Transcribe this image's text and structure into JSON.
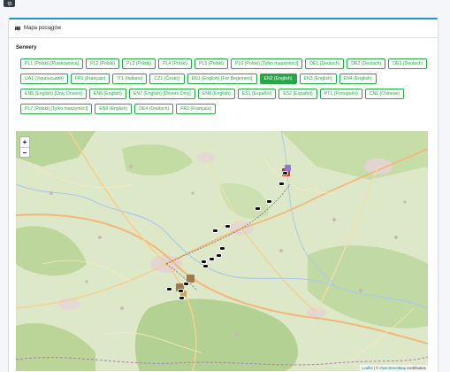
{
  "header": {
    "title": "Mapa pociągów"
  },
  "section_label": "Serwery",
  "servers": [
    {
      "label": "PL1 (Polski) [Piaskownica]",
      "active": false
    },
    {
      "label": "PL2 (Polski)",
      "active": false
    },
    {
      "label": "PL3 (Polski)",
      "active": false
    },
    {
      "label": "PL4 (Polski)",
      "active": false
    },
    {
      "label": "PL5 (Polski)",
      "active": false
    },
    {
      "label": "PL6 (Polski) [Tylko maszyniści]",
      "active": false
    },
    {
      "label": "DE1 (Deutsch)",
      "active": false
    },
    {
      "label": "DE2 (Deutsch)",
      "active": false
    },
    {
      "label": "DE3 (Deutsch)",
      "active": false
    },
    {
      "label": "UA1 (Український)",
      "active": false
    },
    {
      "label": "FR1 (Français)",
      "active": false
    },
    {
      "label": "IT1 (Italiano)",
      "active": false
    },
    {
      "label": "CZ1 (Český)",
      "active": false
    },
    {
      "label": "EN1 (English) [For Beginners]",
      "active": false
    },
    {
      "label": "EN2 (English)",
      "active": true
    },
    {
      "label": "EN3 (English)",
      "active": false
    },
    {
      "label": "EN4 (English)",
      "active": false
    },
    {
      "label": "EN5 (English) [Only Drivers]",
      "active": false
    },
    {
      "label": "EN6 (English)",
      "active": false
    },
    {
      "label": "EN7 (English) [Drivers Only]",
      "active": false
    },
    {
      "label": "EN8 (English)",
      "active": false
    },
    {
      "label": "ES1 (Español)",
      "active": false
    },
    {
      "label": "ES2 (Español)",
      "active": false
    },
    {
      "label": "PT1 (Português)",
      "active": false
    },
    {
      "label": "CN1 (Chinese)",
      "active": false
    },
    {
      "label": "PL7 (Polski) [Tylko maszyniści]",
      "active": false
    },
    {
      "label": "EN9 (English)",
      "active": false
    },
    {
      "label": "DE4 (Deutsch)",
      "active": false
    },
    {
      "label": "FR2 (Français)",
      "active": false
    }
  ],
  "map": {
    "zoom_in": "+",
    "zoom_out": "−",
    "attribution_leaflet": "Leaflet",
    "attribution_sep": " | © ",
    "attribution_osm": "OpenStreetMap",
    "attribution_tail": " contributors",
    "colors": {
      "active": "#28a745",
      "accent": "#17a2b8"
    }
  }
}
